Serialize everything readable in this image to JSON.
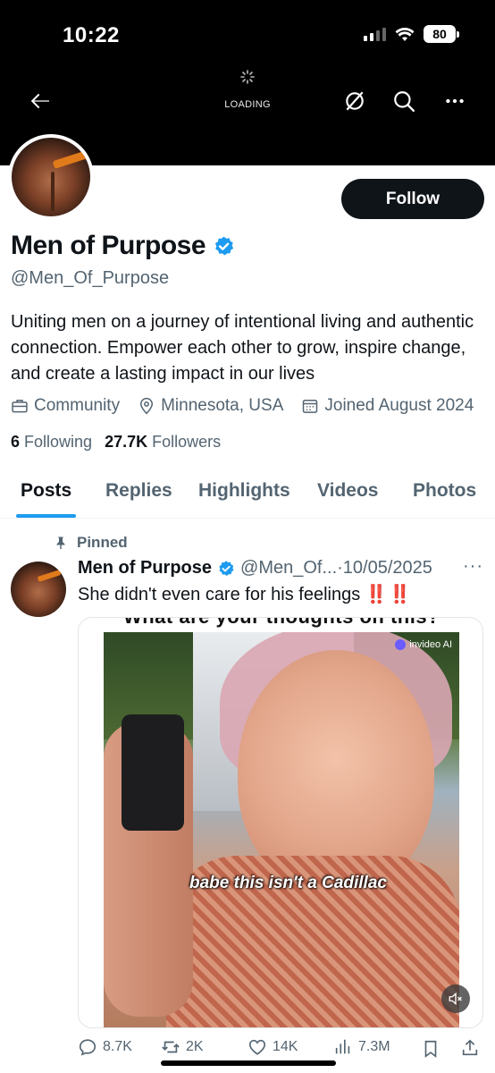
{
  "status_bar": {
    "time": "10:22",
    "battery": "80"
  },
  "top_nav": {
    "loading_text": "LOADING"
  },
  "profile": {
    "display_name": "Men of Purpose",
    "handle": "@Men_Of_Purpose",
    "follow_label": "Follow",
    "bio": "Uniting men on a journey of intentional living and authentic connection. Empower each other to grow, inspire change, and create a lasting impact in our lives",
    "category": "Community",
    "location": "Minnesota, USA",
    "joined": "Joined August 2024",
    "following_count": "6",
    "following_label": "Following",
    "followers_count": "27.7K",
    "followers_label": "Followers",
    "colors": {
      "accent": "#1d9bf0",
      "verified": "#1d9bf0",
      "text": "#0f1419",
      "secondary": "#536471"
    }
  },
  "tabs": [
    {
      "label": "Posts",
      "active": true
    },
    {
      "label": "Replies",
      "active": false
    },
    {
      "label": "Highlights",
      "active": false
    },
    {
      "label": "Videos",
      "active": false
    },
    {
      "label": "Photos",
      "active": false
    }
  ],
  "post": {
    "pinned_label": "Pinned",
    "author_name": "Men of Purpose",
    "author_handle": "@Men_Of...",
    "date": "·10/05/2025",
    "more": "···",
    "text": "She didn't even care for his feelings ",
    "emphasis": "‼️ ‼️",
    "media": {
      "caption": "What are your thoughts on this?",
      "watermark": "invideo AI",
      "subtitle": "babe this isn't a Cadillac",
      "mute_icon": "speaker-muted-icon"
    },
    "stats": {
      "replies": "8.7K",
      "reposts": "2K",
      "likes": "14K",
      "views": "7.3M"
    }
  }
}
